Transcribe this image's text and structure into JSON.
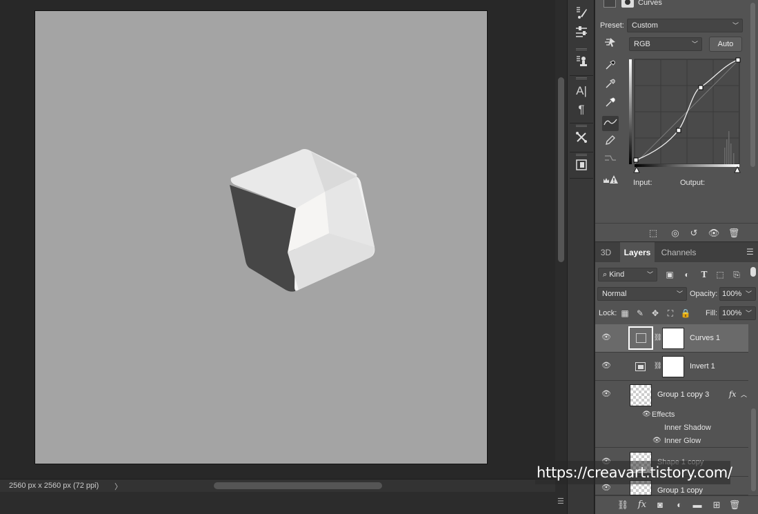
{
  "status": {
    "doc_info": "2560 px x 2560 px (72 ppi)",
    "arrow": "〉"
  },
  "properties": {
    "title": "Curves",
    "preset_label": "Preset:",
    "preset_value": "Custom",
    "channel_value": "RGB",
    "auto_label": "Auto",
    "input_label": "Input:",
    "output_label": "Output:"
  },
  "tabs": [
    "3D",
    "Layers",
    "Channels"
  ],
  "layers_controls": {
    "kind_label": "Kind",
    "blend_mode": "Normal",
    "opacity_label": "Opacity:",
    "opacity_value": "100%",
    "lock_label": "Lock:",
    "fill_label": "Fill:",
    "fill_value": "100%"
  },
  "layers": [
    {
      "name": "Curves 1",
      "selected": true
    },
    {
      "name": "Invert 1"
    },
    {
      "name": "Group 1 copy 3",
      "fx": "fx"
    },
    {
      "name": "Shape 1 copy"
    },
    {
      "name": "Group 1 copy"
    }
  ],
  "effects": {
    "header": "Effects",
    "items": [
      "Inner Shadow",
      "Inner Glow"
    ]
  },
  "watermark": "https://creavart.tistory.com/",
  "icons": {
    "tools": [
      "brush-settings-icon",
      "adjustments-icon",
      "clone-source-icon",
      "character-icon",
      "paragraph-icon",
      "tool-presets-icon",
      "libraries-icon"
    ],
    "props_side": [
      "on-image-adjust-icon",
      "black-eyedropper-icon",
      "gray-eyedropper-icon",
      "white-eyedropper-icon",
      "curve-point-icon",
      "pencil-icon",
      "smooth-icon",
      "clipping-warning-icon"
    ]
  },
  "colors": {
    "canvas": "#a4a4a4",
    "panel": "#535353",
    "workspace": "#282828"
  }
}
